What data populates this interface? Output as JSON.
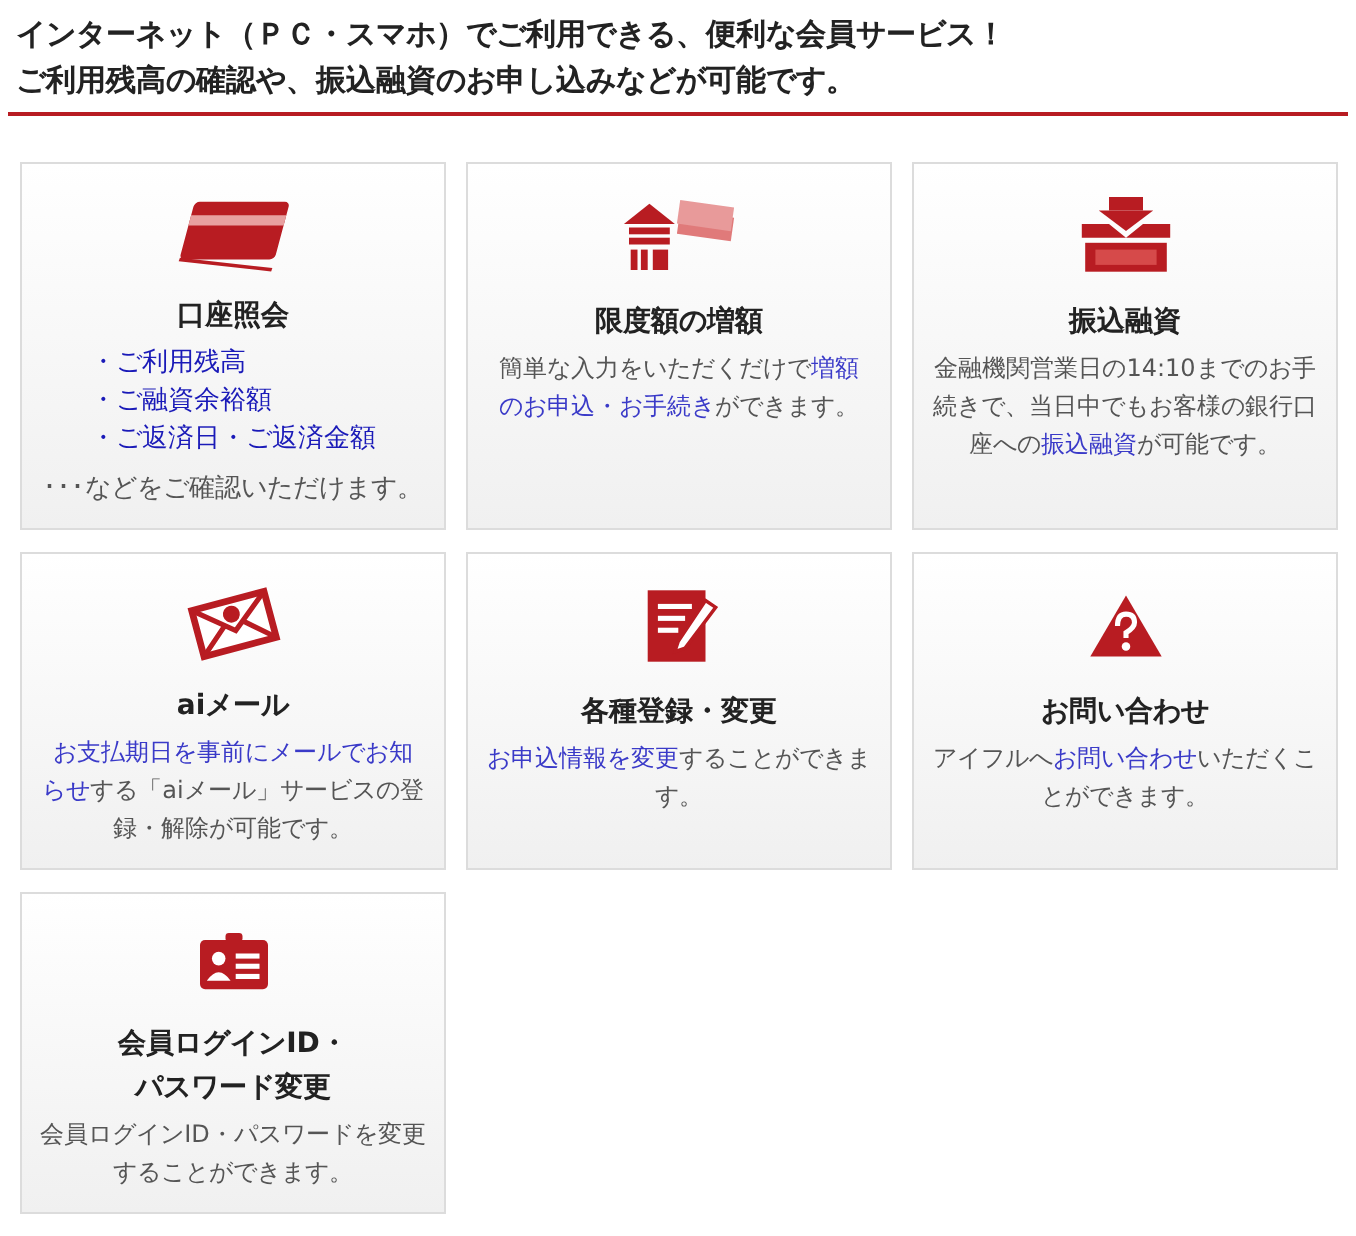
{
  "header": {
    "lines": [
      "インターネット（ＰＣ・スマホ）でご利用できる、便利な会員サービス！",
      "ご利用残高の確認や、振込融資のお申し込みなどが可能です。"
    ]
  },
  "cards": [
    {
      "kind": "card",
      "title_lines": [
        "口座照会"
      ],
      "items": [
        "・ご利用残高",
        "・ご融資余裕額",
        "・ご返済日・ご返済金額"
      ],
      "note": "･･･などをご確認いただけます。"
    },
    {
      "kind": "up",
      "title_lines": [
        "限度額の増額"
      ],
      "body": [
        {
          "text": "簡単な入力をいただくだけで",
          "link": false
        },
        {
          "text": "増額",
          "link": true
        },
        {
          "text": "のお申込・お手続き",
          "link": true
        },
        {
          "text": "ができます。",
          "link": false
        }
      ]
    },
    {
      "kind": "bank",
      "title_lines": [
        "振込融資"
      ],
      "body": [
        {
          "text": "金融機関営業日の14:10までのお手続きで、当日中でもお客様の銀行口座への",
          "link": false
        },
        {
          "text": "振込融資",
          "link": true
        },
        {
          "text": "が可能です。",
          "link": false
        }
      ]
    },
    {
      "kind": "mail",
      "title_lines": [
        "aiメール"
      ],
      "body": [
        {
          "text": "お支払期日を事前にメールでお知",
          "link": true
        },
        {
          "text": "らせ",
          "link": true
        },
        {
          "text": "する「aiメール」サービスの登録・解除が可能です。",
          "link": false
        }
      ]
    },
    {
      "kind": "memo",
      "title_lines": [
        "各種登録・変更"
      ],
      "body": [
        {
          "text": "お申込情報を変更",
          "link": true
        },
        {
          "text": "することができます。",
          "link": false
        }
      ]
    },
    {
      "kind": "warning",
      "title_lines": [
        "お問い合わせ"
      ],
      "body": [
        {
          "text": "アイフルへ",
          "link": false
        },
        {
          "text": "お問い合わせ",
          "link": true
        },
        {
          "text": "いただくことができます。",
          "link": false
        }
      ]
    },
    {
      "kind": "id",
      "title_lines": [
        "会員ログインID・",
        "パスワード変更"
      ],
      "body": [
        {
          "text": "会員ログインID・パスワードを変更することができます。",
          "link": false
        }
      ]
    }
  ]
}
